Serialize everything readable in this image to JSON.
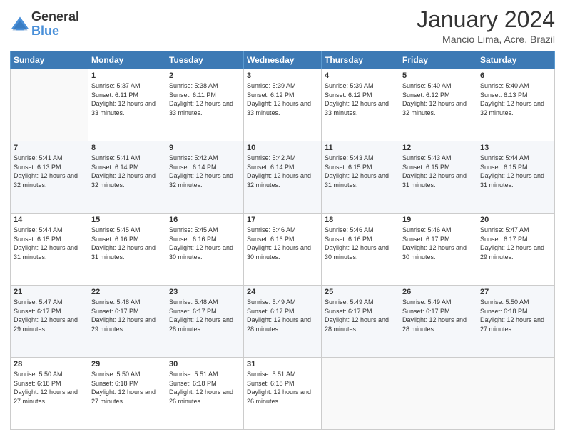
{
  "logo": {
    "text_general": "General",
    "text_blue": "Blue"
  },
  "header": {
    "month_title": "January 2024",
    "location": "Mancio Lima, Acre, Brazil"
  },
  "days_of_week": [
    "Sunday",
    "Monday",
    "Tuesday",
    "Wednesday",
    "Thursday",
    "Friday",
    "Saturday"
  ],
  "weeks": [
    [
      {
        "day": "",
        "sunrise": "",
        "sunset": "",
        "daylight": ""
      },
      {
        "day": "1",
        "sunrise": "Sunrise: 5:37 AM",
        "sunset": "Sunset: 6:11 PM",
        "daylight": "Daylight: 12 hours and 33 minutes."
      },
      {
        "day": "2",
        "sunrise": "Sunrise: 5:38 AM",
        "sunset": "Sunset: 6:11 PM",
        "daylight": "Daylight: 12 hours and 33 minutes."
      },
      {
        "day": "3",
        "sunrise": "Sunrise: 5:39 AM",
        "sunset": "Sunset: 6:12 PM",
        "daylight": "Daylight: 12 hours and 33 minutes."
      },
      {
        "day": "4",
        "sunrise": "Sunrise: 5:39 AM",
        "sunset": "Sunset: 6:12 PM",
        "daylight": "Daylight: 12 hours and 33 minutes."
      },
      {
        "day": "5",
        "sunrise": "Sunrise: 5:40 AM",
        "sunset": "Sunset: 6:12 PM",
        "daylight": "Daylight: 12 hours and 32 minutes."
      },
      {
        "day": "6",
        "sunrise": "Sunrise: 5:40 AM",
        "sunset": "Sunset: 6:13 PM",
        "daylight": "Daylight: 12 hours and 32 minutes."
      }
    ],
    [
      {
        "day": "7",
        "sunrise": "Sunrise: 5:41 AM",
        "sunset": "Sunset: 6:13 PM",
        "daylight": "Daylight: 12 hours and 32 minutes."
      },
      {
        "day": "8",
        "sunrise": "Sunrise: 5:41 AM",
        "sunset": "Sunset: 6:14 PM",
        "daylight": "Daylight: 12 hours and 32 minutes."
      },
      {
        "day": "9",
        "sunrise": "Sunrise: 5:42 AM",
        "sunset": "Sunset: 6:14 PM",
        "daylight": "Daylight: 12 hours and 32 minutes."
      },
      {
        "day": "10",
        "sunrise": "Sunrise: 5:42 AM",
        "sunset": "Sunset: 6:14 PM",
        "daylight": "Daylight: 12 hours and 32 minutes."
      },
      {
        "day": "11",
        "sunrise": "Sunrise: 5:43 AM",
        "sunset": "Sunset: 6:15 PM",
        "daylight": "Daylight: 12 hours and 31 minutes."
      },
      {
        "day": "12",
        "sunrise": "Sunrise: 5:43 AM",
        "sunset": "Sunset: 6:15 PM",
        "daylight": "Daylight: 12 hours and 31 minutes."
      },
      {
        "day": "13",
        "sunrise": "Sunrise: 5:44 AM",
        "sunset": "Sunset: 6:15 PM",
        "daylight": "Daylight: 12 hours and 31 minutes."
      }
    ],
    [
      {
        "day": "14",
        "sunrise": "Sunrise: 5:44 AM",
        "sunset": "Sunset: 6:15 PM",
        "daylight": "Daylight: 12 hours and 31 minutes."
      },
      {
        "day": "15",
        "sunrise": "Sunrise: 5:45 AM",
        "sunset": "Sunset: 6:16 PM",
        "daylight": "Daylight: 12 hours and 31 minutes."
      },
      {
        "day": "16",
        "sunrise": "Sunrise: 5:45 AM",
        "sunset": "Sunset: 6:16 PM",
        "daylight": "Daylight: 12 hours and 30 minutes."
      },
      {
        "day": "17",
        "sunrise": "Sunrise: 5:46 AM",
        "sunset": "Sunset: 6:16 PM",
        "daylight": "Daylight: 12 hours and 30 minutes."
      },
      {
        "day": "18",
        "sunrise": "Sunrise: 5:46 AM",
        "sunset": "Sunset: 6:16 PM",
        "daylight": "Daylight: 12 hours and 30 minutes."
      },
      {
        "day": "19",
        "sunrise": "Sunrise: 5:46 AM",
        "sunset": "Sunset: 6:17 PM",
        "daylight": "Daylight: 12 hours and 30 minutes."
      },
      {
        "day": "20",
        "sunrise": "Sunrise: 5:47 AM",
        "sunset": "Sunset: 6:17 PM",
        "daylight": "Daylight: 12 hours and 29 minutes."
      }
    ],
    [
      {
        "day": "21",
        "sunrise": "Sunrise: 5:47 AM",
        "sunset": "Sunset: 6:17 PM",
        "daylight": "Daylight: 12 hours and 29 minutes."
      },
      {
        "day": "22",
        "sunrise": "Sunrise: 5:48 AM",
        "sunset": "Sunset: 6:17 PM",
        "daylight": "Daylight: 12 hours and 29 minutes."
      },
      {
        "day": "23",
        "sunrise": "Sunrise: 5:48 AM",
        "sunset": "Sunset: 6:17 PM",
        "daylight": "Daylight: 12 hours and 28 minutes."
      },
      {
        "day": "24",
        "sunrise": "Sunrise: 5:49 AM",
        "sunset": "Sunset: 6:17 PM",
        "daylight": "Daylight: 12 hours and 28 minutes."
      },
      {
        "day": "25",
        "sunrise": "Sunrise: 5:49 AM",
        "sunset": "Sunset: 6:17 PM",
        "daylight": "Daylight: 12 hours and 28 minutes."
      },
      {
        "day": "26",
        "sunrise": "Sunrise: 5:49 AM",
        "sunset": "Sunset: 6:17 PM",
        "daylight": "Daylight: 12 hours and 28 minutes."
      },
      {
        "day": "27",
        "sunrise": "Sunrise: 5:50 AM",
        "sunset": "Sunset: 6:18 PM",
        "daylight": "Daylight: 12 hours and 27 minutes."
      }
    ],
    [
      {
        "day": "28",
        "sunrise": "Sunrise: 5:50 AM",
        "sunset": "Sunset: 6:18 PM",
        "daylight": "Daylight: 12 hours and 27 minutes."
      },
      {
        "day": "29",
        "sunrise": "Sunrise: 5:50 AM",
        "sunset": "Sunset: 6:18 PM",
        "daylight": "Daylight: 12 hours and 27 minutes."
      },
      {
        "day": "30",
        "sunrise": "Sunrise: 5:51 AM",
        "sunset": "Sunset: 6:18 PM",
        "daylight": "Daylight: 12 hours and 26 minutes."
      },
      {
        "day": "31",
        "sunrise": "Sunrise: 5:51 AM",
        "sunset": "Sunset: 6:18 PM",
        "daylight": "Daylight: 12 hours and 26 minutes."
      },
      {
        "day": "",
        "sunrise": "",
        "sunset": "",
        "daylight": ""
      },
      {
        "day": "",
        "sunrise": "",
        "sunset": "",
        "daylight": ""
      },
      {
        "day": "",
        "sunrise": "",
        "sunset": "",
        "daylight": ""
      }
    ]
  ]
}
